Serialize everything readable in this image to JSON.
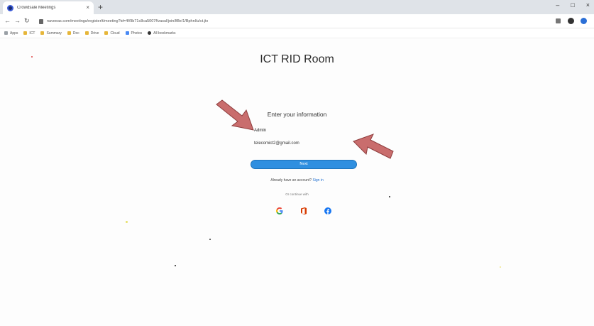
{
  "browser": {
    "tab_title": "Crowdsale Meetings",
    "tab_close": "×",
    "new_tab": "+",
    "url": "naveeas.com/meetings/register/t/meeting?id=4f/9b71c8ca5007f/vasul/join/lf8e/1/Bphnl/u/ct.jtx",
    "window_controls": [
      "–",
      "□",
      "×"
    ],
    "bookmarks": [
      "Apps",
      "ICT",
      "Summary",
      "Doc",
      "Drive",
      "Cloud",
      "Photos",
      "All bookmarks"
    ]
  },
  "page": {
    "title": "ICT RID Room",
    "form_heading": "Enter your information",
    "name_value": "Admin",
    "email_value": "telecomict2@gmail.com",
    "next_label": "Next",
    "signin_prompt": "Already have an account?",
    "signin_link": "Sign in",
    "or_text": "Or continue with"
  },
  "social_icons": [
    "google-icon",
    "office-icon",
    "facebook-icon"
  ],
  "colors": {
    "accent": "#2f8fe0",
    "arrow": "#c96d6d"
  }
}
